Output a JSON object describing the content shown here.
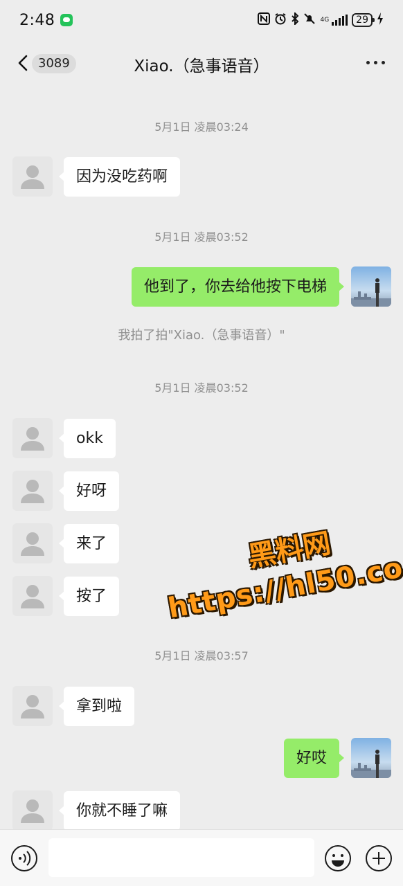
{
  "status_bar": {
    "time": "2:48",
    "network": "4G",
    "battery": "29",
    "icons": [
      "wechat-icon",
      "nfc-icon",
      "alarm-icon",
      "bluetooth-icon",
      "mute-icon",
      "signal-icon",
      "battery-icon",
      "charging-icon"
    ]
  },
  "header": {
    "back_icon": "chevron-left-icon",
    "unread_count": "3089",
    "title": "Xiao.（急事语音）",
    "more_icon": "more-icon"
  },
  "messages": [
    {
      "kind": "timestamp",
      "text": "5月1日 凌晨03:24"
    },
    {
      "kind": "incoming",
      "text": "因为没吃药啊"
    },
    {
      "kind": "timestamp",
      "text": "5月1日 凌晨03:52"
    },
    {
      "kind": "outgoing",
      "text": "他到了，你去给他按下电梯"
    },
    {
      "kind": "system",
      "text": "我拍了拍\"Xiao.（急事语音）\""
    },
    {
      "kind": "timestamp",
      "text": "5月1日 凌晨03:52"
    },
    {
      "kind": "incoming",
      "text": "okk"
    },
    {
      "kind": "incoming",
      "text": "好呀"
    },
    {
      "kind": "incoming",
      "text": "来了"
    },
    {
      "kind": "incoming",
      "text": "按了"
    },
    {
      "kind": "timestamp",
      "text": "5月1日 凌晨03:57"
    },
    {
      "kind": "incoming",
      "text": "拿到啦"
    },
    {
      "kind": "outgoing",
      "text": "好哎"
    },
    {
      "kind": "incoming",
      "text": "你就不睡了嘛"
    }
  ],
  "watermark": {
    "line1": "黑料网",
    "line2": "https://hl50.co"
  },
  "input_bar": {
    "voice_icon": "voice-icon",
    "input_value": "",
    "emoji_icon": "emoji-icon",
    "plus_icon": "plus-icon"
  },
  "colors": {
    "background": "#ededed",
    "incoming_bubble": "#ffffff",
    "outgoing_bubble": "#95ec69",
    "timestamp_text": "#8f8f8f",
    "watermark": "#ff9a18"
  }
}
